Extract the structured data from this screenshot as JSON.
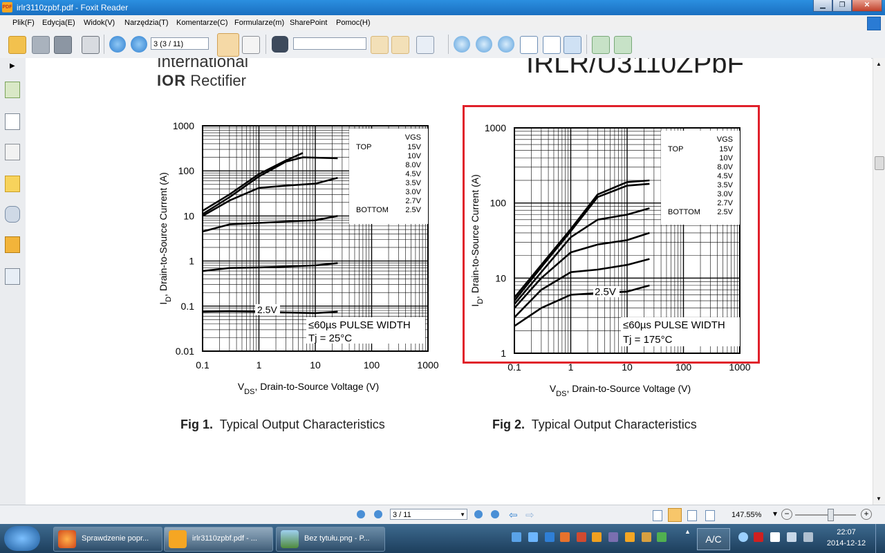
{
  "window": {
    "title": "irlr3110zpbf.pdf - Foxit Reader",
    "app_icon_text": "PDF"
  },
  "menu": [
    "Plik(F)",
    "Edycja(E)",
    "Widok(V)",
    "Narzędzia(T)",
    "Komentarze(C)",
    "Formularze(m)",
    "SharePoint",
    "Pomoc(H)"
  ],
  "toolbar": {
    "page_field": "3 (3 / 11)",
    "search_field": ""
  },
  "page": {
    "brand_line1": "International",
    "brand_line2_logo": "IOR",
    "brand_line2": "Rectifier",
    "part_number": "IRLR/U3110ZPbF",
    "fig1_caption_num": "Fig 1.",
    "fig1_caption": "Typical Output Characteristics",
    "fig2_caption_num": "Fig 2.",
    "fig2_caption": "Typical Output Characteristics"
  },
  "chart_data": [
    {
      "type": "line",
      "title": "",
      "xlabel": "V",
      "xlabel_sub": "DS",
      "xlabel_rest": ", Drain-to-Source Voltage (V)",
      "ylabel": "I",
      "ylabel_sub": "D",
      "ylabel_rest": ", Drain-to-Source Current (A)",
      "x_scale": "log",
      "y_scale": "log",
      "xlim": [
        0.1,
        1000
      ],
      "ylim": [
        0.01,
        1000
      ],
      "x_ticks": [
        "0.1",
        "1",
        "10",
        "100",
        "1000"
      ],
      "y_ticks": [
        "0.01",
        "0.1",
        "1",
        "10",
        "100",
        "1000"
      ],
      "legend": {
        "header": "VGS",
        "top_label": "TOP",
        "bottom_label": "BOTTOM",
        "entries": [
          "15V",
          "10V",
          "8.0V",
          "4.5V",
          "3.5V",
          "3.0V",
          "2.7V",
          "2.5V"
        ],
        "placement": "top-right"
      },
      "annotations": [
        "2.5V",
        "≤60µs PULSE WIDTH",
        "Tj = 25°C"
      ],
      "series": [
        {
          "values": [
            [
              0.1,
              13
            ],
            [
              0.3,
              30
            ],
            [
              1,
              85
            ],
            [
              3,
              170
            ],
            [
              6,
              250
            ]
          ]
        },
        {
          "values": [
            [
              0.1,
              11
            ],
            [
              0.3,
              26
            ],
            [
              1,
              75
            ],
            [
              3,
              160
            ],
            [
              6,
              200
            ],
            [
              25,
              190
            ]
          ]
        },
        {
          "values": [
            [
              0.1,
              10
            ],
            [
              0.3,
              22
            ],
            [
              1,
              42
            ],
            [
              3,
              47
            ],
            [
              10,
              52
            ],
            [
              25,
              70
            ]
          ]
        },
        {
          "values": [
            [
              0.1,
              4.5
            ],
            [
              0.3,
              6.5
            ],
            [
              1,
              7
            ],
            [
              3,
              7.5
            ],
            [
              10,
              8
            ],
            [
              25,
              10
            ]
          ]
        },
        {
          "values": [
            [
              0.1,
              0.6
            ],
            [
              0.3,
              0.7
            ],
            [
              1,
              0.72
            ],
            [
              3,
              0.75
            ],
            [
              10,
              0.8
            ],
            [
              25,
              0.9
            ]
          ]
        },
        {
          "values": [
            [
              0.1,
              0.075
            ],
            [
              0.3,
              0.077
            ],
            [
              1,
              0.075
            ],
            [
              3,
              0.072
            ],
            [
              10,
              0.07
            ],
            [
              25,
              0.075
            ]
          ]
        }
      ]
    },
    {
      "type": "line",
      "title": "",
      "xlabel": "V",
      "xlabel_sub": "DS",
      "xlabel_rest": ", Drain-to-Source Voltage (V)",
      "ylabel": "I",
      "ylabel_sub": "D",
      "ylabel_rest": ", Drain-to-Source Current (A)",
      "x_scale": "log",
      "y_scale": "log",
      "xlim": [
        0.1,
        1000
      ],
      "ylim": [
        1,
        1000
      ],
      "x_ticks": [
        "0.1",
        "1",
        "10",
        "100",
        "1000"
      ],
      "y_ticks": [
        "1",
        "10",
        "100",
        "1000"
      ],
      "legend": {
        "header": "VGS",
        "top_label": "TOP",
        "bottom_label": "BOTTOM",
        "entries": [
          "15V",
          "10V",
          "8.0V",
          "4.5V",
          "3.5V",
          "3.0V",
          "2.7V",
          "2.5V"
        ],
        "placement": "top-right"
      },
      "annotations": [
        "2.5V",
        "≤60µs PULSE WIDTH",
        "Tj = 175°C"
      ],
      "series": [
        {
          "values": [
            [
              0.1,
              5.5
            ],
            [
              0.3,
              15
            ],
            [
              1,
              45
            ],
            [
              3,
              130
            ],
            [
              10,
              190
            ],
            [
              25,
              200
            ]
          ]
        },
        {
          "values": [
            [
              0.1,
              5
            ],
            [
              0.3,
              14
            ],
            [
              1,
              42
            ],
            [
              3,
              120
            ],
            [
              10,
              170
            ],
            [
              25,
              180
            ]
          ]
        },
        {
          "values": [
            [
              0.1,
              4.5
            ],
            [
              0.3,
              12
            ],
            [
              1,
              35
            ],
            [
              3,
              60
            ],
            [
              10,
              70
            ],
            [
              25,
              85
            ]
          ]
        },
        {
          "values": [
            [
              0.1,
              4
            ],
            [
              0.3,
              10
            ],
            [
              1,
              22
            ],
            [
              3,
              28
            ],
            [
              10,
              32
            ],
            [
              25,
              40
            ]
          ]
        },
        {
          "values": [
            [
              0.1,
              3
            ],
            [
              0.3,
              7
            ],
            [
              1,
              12
            ],
            [
              3,
              13
            ],
            [
              10,
              15
            ],
            [
              25,
              18
            ]
          ]
        },
        {
          "values": [
            [
              0.1,
              2.3
            ],
            [
              0.3,
              4
            ],
            [
              1,
              6
            ],
            [
              3,
              6.3
            ],
            [
              10,
              6.6
            ],
            [
              25,
              8
            ]
          ]
        }
      ]
    }
  ],
  "statusbar": {
    "page_field": "3 / 11",
    "zoom": "147.55%"
  },
  "taskbar": {
    "tasks": [
      "Sprawdzenie popr...",
      "irlr3110zpbf.pdf - ...",
      "Bez tytułu.png - P..."
    ],
    "lang": "A/C",
    "time": "22:07",
    "date": "2014-12-12"
  },
  "colors": {
    "highlight_box": "#e0202a",
    "titlebar": "#1e7fd0",
    "taskbar": "#2a5374"
  }
}
